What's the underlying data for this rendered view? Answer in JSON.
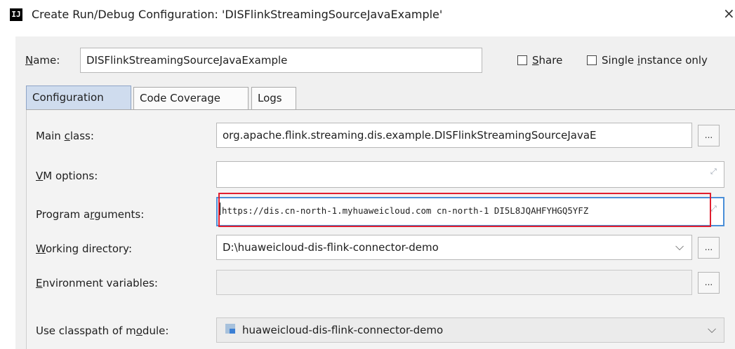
{
  "window": {
    "icon_text": "IJ",
    "title": "Create Run/Debug Configuration: 'DISFlinkStreamingSourceJavaExample'",
    "close_glyph": "×"
  },
  "name_row": {
    "label_underlined": "N",
    "label_rest": "ame:",
    "value": "DISFlinkStreamingSourceJavaExample",
    "share_underlined": "S",
    "share_rest": "hare",
    "share_checked": false,
    "single_prefix": "Single ",
    "single_underlined": "i",
    "single_rest": "nstance only",
    "single_checked": false
  },
  "tabs": [
    {
      "label": "Configuration",
      "active": true
    },
    {
      "label": "Code Coverage",
      "active": false
    },
    {
      "label": "Logs",
      "active": false
    }
  ],
  "fields": {
    "main_class": {
      "label_prefix": "Main ",
      "label_underlined": "c",
      "label_rest": "lass:",
      "value": "org.apache.flink.streaming.dis.example.DISFlinkStreamingSourceJavaE",
      "button": "..."
    },
    "vm_options": {
      "label_underlined": "V",
      "label_rest": "M options:",
      "value": ""
    },
    "program_arguments": {
      "label_prefix": "Program a",
      "label_underlined": "r",
      "label_rest": "guments:",
      "value": "https://dis.cn-north-1.myhuaweicloud.com cn-north-1 DI5L8JQAHFYHGQ5YFZ"
    },
    "working_directory": {
      "label_underlined": "W",
      "label_rest": "orking directory:",
      "value": "D:\\huaweicloud-dis-flink-connector-demo",
      "button": "..."
    },
    "environment_variables": {
      "label_underlined": "E",
      "label_rest": "nvironment variables:",
      "value": "",
      "button": "..."
    },
    "classpath_module": {
      "label_prefix": "Use classpath of m",
      "label_underlined": "o",
      "label_rest": "dule:",
      "value": "huaweicloud-dis-flink-connector-demo"
    }
  },
  "icons": {
    "expand": "expand-arrows-icon",
    "dropdown": "chevron-down-icon",
    "module": "module-folder-icon",
    "app": "intellij-app-icon"
  },
  "colors": {
    "active_tab": "#cfdcee",
    "highlight_box": "#e01e2f",
    "panel": "#f0f0f0"
  }
}
